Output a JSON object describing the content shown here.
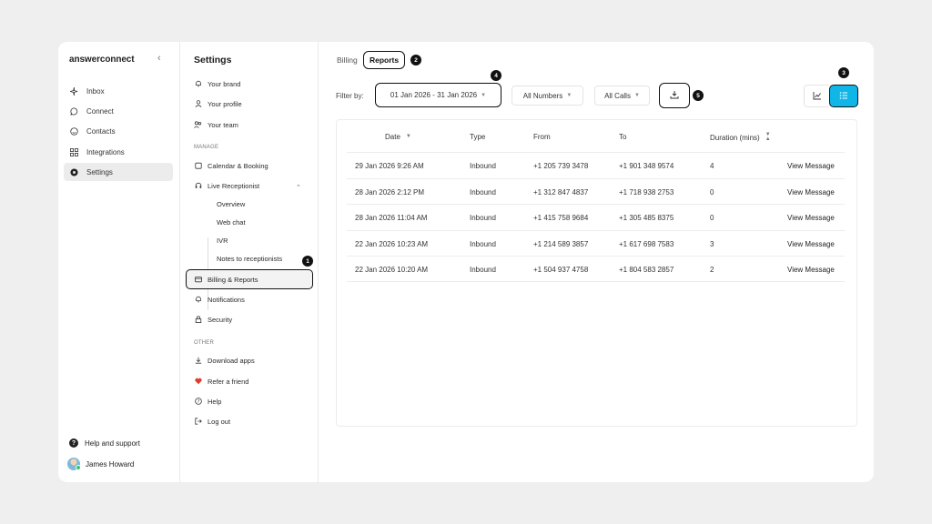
{
  "app": {
    "logo_main": "answerconnect",
    "collapse_icon": "chevron-left-icon"
  },
  "nav": {
    "items": [
      {
        "label": "Inbox",
        "icon": "bolt-icon"
      },
      {
        "label": "Connect",
        "icon": "chat-bubble-icon"
      },
      {
        "label": "Contacts",
        "icon": "smiley-icon"
      },
      {
        "label": "Integrations",
        "icon": "grid-icon"
      },
      {
        "label": "Settings",
        "icon": "gear-icon",
        "active": true
      }
    ],
    "help_label": "Help and support",
    "user_name": "James Howard"
  },
  "settings": {
    "title": "Settings",
    "items_top": [
      {
        "label": "Your brand",
        "icon": "bell-icon"
      },
      {
        "label": "Your profile",
        "icon": "person-icon"
      },
      {
        "label": "Your team",
        "icon": "team-icon"
      }
    ],
    "section_manage": "MANAGE",
    "calendar_label": "Calendar & Booking",
    "live_receptionist_label": "Live Receptionist",
    "sub_items": [
      "Overview",
      "Web chat",
      "IVR",
      "Notes to receptionists"
    ],
    "billing_reports_label": "Billing & Reports",
    "notifications_label": "Notifications",
    "security_label": "Security",
    "section_other": "OTHER",
    "download_label": "Download apps",
    "refer_label": "Refer a friend",
    "help_label": "Help",
    "logout_label": "Log out"
  },
  "badges": [
    "1",
    "2",
    "3",
    "4",
    "5"
  ],
  "main": {
    "tabs": [
      "Billing",
      "Reports"
    ],
    "filter_label": "Filter by:",
    "date_range": "01 Jan 2026 - 31 Jan 2026",
    "numbers_filter": "All Numbers",
    "calls_filter": "All Calls",
    "accent_color": "#10b6e8"
  },
  "table": {
    "columns": [
      "Date",
      "Type",
      "From",
      "To",
      "Duration (mins)"
    ],
    "rows": [
      {
        "date": "29 Jan 2026 9:26 AM",
        "type": "Inbound",
        "from": "+1 205 739 3478",
        "to": "+1 901 348 9574",
        "duration": "4",
        "action": "View Message"
      },
      {
        "date": "28 Jan 2026 2:12 PM",
        "type": "Inbound",
        "from": "+1 312 847 4837",
        "to": "+1 718 938 2753",
        "duration": "0",
        "action": "View Message"
      },
      {
        "date": "28 Jan 2026 11:04 AM",
        "type": "Inbound",
        "from": "+1 415 758 9684",
        "to": "+1 305 485 8375",
        "duration": "0",
        "action": "View Message"
      },
      {
        "date": "22 Jan 2026 10:23 AM",
        "type": "Inbound",
        "from": "+1 214 589 3857",
        "to": "+1 617 698 7583",
        "duration": "3",
        "action": "View Message"
      },
      {
        "date": "22 Jan 2026 10:20 AM",
        "type": "Inbound",
        "from": "+1 504 937 4758",
        "to": "+1 804 583 2857",
        "duration": "2",
        "action": "View Message"
      }
    ]
  }
}
